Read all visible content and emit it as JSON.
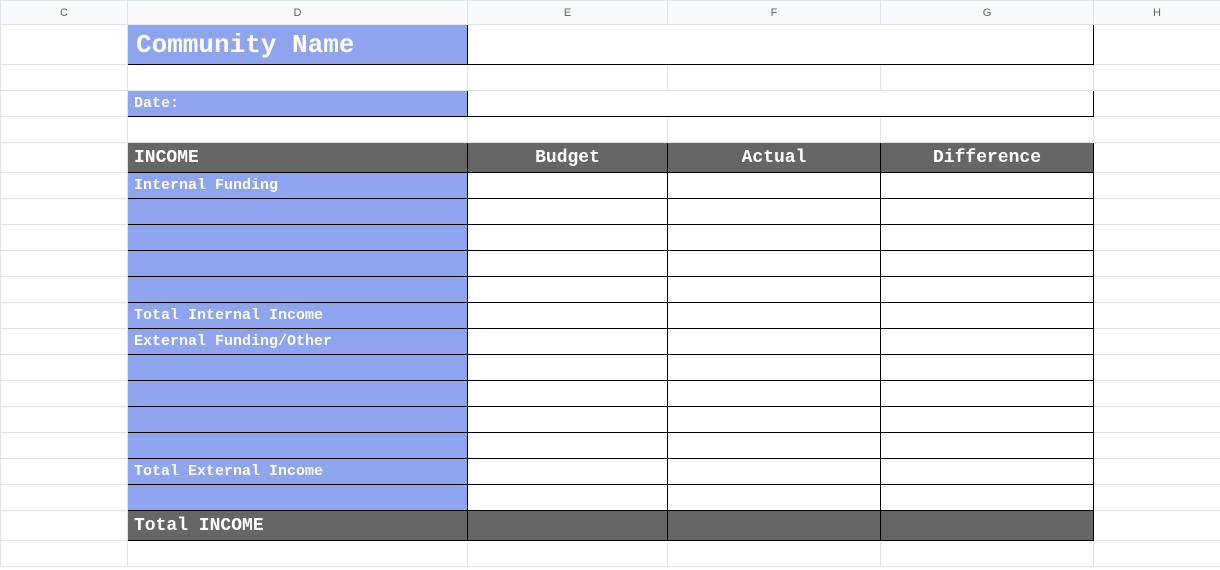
{
  "columns": {
    "c": "C",
    "d": "D",
    "e": "E",
    "f": "F",
    "g": "G",
    "h": "H"
  },
  "title": "Community Name",
  "date_label": "Date:",
  "date_value": "",
  "income_header": {
    "label": "INCOME",
    "budget": "Budget",
    "actual": "Actual",
    "difference": "Difference"
  },
  "rows": {
    "internal_funding": "Internal Funding",
    "blank1": "",
    "blank2": "",
    "blank3": "",
    "blank4": "",
    "total_internal": "Total Internal Income",
    "external_funding": "External Funding/Other",
    "eblank1": "",
    "eblank2": "",
    "eblank3": "",
    "eblank4": "",
    "total_external": "Total External Income",
    "pre_total_blank": ""
  },
  "total_income_label": "Total INCOME",
  "colors": {
    "blue": "#8ea4ee",
    "grey": "#666666"
  }
}
